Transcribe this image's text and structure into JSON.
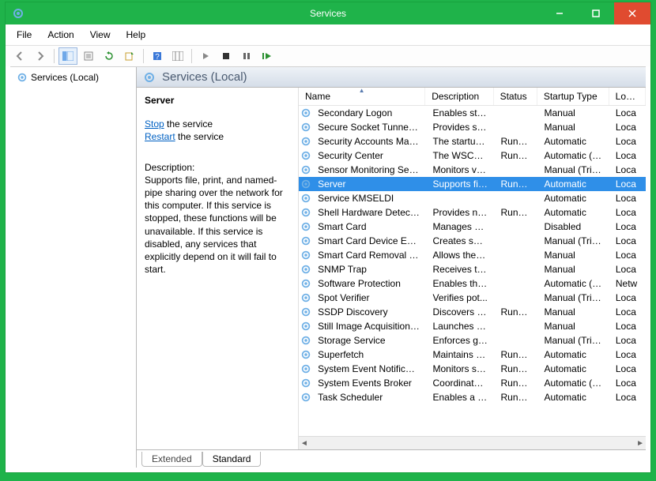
{
  "window": {
    "title": "Services"
  },
  "menu": {
    "file": "File",
    "action": "Action",
    "view": "View",
    "help": "Help"
  },
  "tree": {
    "root": "Services (Local)"
  },
  "header": {
    "title": "Services (Local)"
  },
  "detail": {
    "name": "Server",
    "stop_label": "Stop",
    "stop_suffix": " the service",
    "restart_label": "Restart",
    "restart_suffix": " the service",
    "desc_label": "Description:",
    "desc_text": "Supports file, print, and named-pipe sharing over the network for this computer. If this service is stopped, these functions will be unavailable. If this service is disabled, any services that explicitly depend on it will fail to start."
  },
  "columns": {
    "name": "Name",
    "description": "Description",
    "status": "Status",
    "startup": "Startup Type",
    "logon": "Log On As"
  },
  "rows": [
    {
      "name": "Secondary Logon",
      "description": "Enables star...",
      "status": "",
      "startup": "Manual",
      "logon": "Loca",
      "selected": false
    },
    {
      "name": "Secure Socket Tunneling Pr...",
      "description": "Provides su...",
      "status": "",
      "startup": "Manual",
      "logon": "Loca",
      "selected": false
    },
    {
      "name": "Security Accounts Manager",
      "description": "The startup ...",
      "status": "Running",
      "startup": "Automatic",
      "logon": "Loca",
      "selected": false
    },
    {
      "name": "Security Center",
      "description": "The WSCSV...",
      "status": "Running",
      "startup": "Automatic (D...",
      "logon": "Loca",
      "selected": false
    },
    {
      "name": "Sensor Monitoring Service",
      "description": "Monitors va...",
      "status": "",
      "startup": "Manual (Trig...",
      "logon": "Loca",
      "selected": false
    },
    {
      "name": "Server",
      "description": "Supports fil...",
      "status": "Running",
      "startup": "Automatic",
      "logon": "Loca",
      "selected": true
    },
    {
      "name": "Service KMSELDI",
      "description": "",
      "status": "",
      "startup": "Automatic",
      "logon": "Loca",
      "selected": false
    },
    {
      "name": "Shell Hardware Detection",
      "description": "Provides no...",
      "status": "Running",
      "startup": "Automatic",
      "logon": "Loca",
      "selected": false
    },
    {
      "name": "Smart Card",
      "description": "Manages ac...",
      "status": "",
      "startup": "Disabled",
      "logon": "Loca",
      "selected": false
    },
    {
      "name": "Smart Card Device Enumera...",
      "description": "Creates soft...",
      "status": "",
      "startup": "Manual (Trig...",
      "logon": "Loca",
      "selected": false
    },
    {
      "name": "Smart Card Removal Policy",
      "description": "Allows the s...",
      "status": "",
      "startup": "Manual",
      "logon": "Loca",
      "selected": false
    },
    {
      "name": "SNMP Trap",
      "description": "Receives tra...",
      "status": "",
      "startup": "Manual",
      "logon": "Loca",
      "selected": false
    },
    {
      "name": "Software Protection",
      "description": "Enables the ...",
      "status": "",
      "startup": "Automatic (D...",
      "logon": "Netw",
      "selected": false
    },
    {
      "name": "Spot Verifier",
      "description": "Verifies pot...",
      "status": "",
      "startup": "Manual (Trig...",
      "logon": "Loca",
      "selected": false
    },
    {
      "name": "SSDP Discovery",
      "description": "Discovers n...",
      "status": "Running",
      "startup": "Manual",
      "logon": "Loca",
      "selected": false
    },
    {
      "name": "Still Image Acquisition Events",
      "description": "Launches a...",
      "status": "",
      "startup": "Manual",
      "logon": "Loca",
      "selected": false
    },
    {
      "name": "Storage Service",
      "description": "Enforces gr...",
      "status": "",
      "startup": "Manual (Trig...",
      "logon": "Loca",
      "selected": false
    },
    {
      "name": "Superfetch",
      "description": "Maintains a...",
      "status": "Running",
      "startup": "Automatic",
      "logon": "Loca",
      "selected": false
    },
    {
      "name": "System Event Notification S...",
      "description": "Monitors sy...",
      "status": "Running",
      "startup": "Automatic",
      "logon": "Loca",
      "selected": false
    },
    {
      "name": "System Events Broker",
      "description": "Coordinates...",
      "status": "Running",
      "startup": "Automatic (T...",
      "logon": "Loca",
      "selected": false
    },
    {
      "name": "Task Scheduler",
      "description": "Enables a us...",
      "status": "Running",
      "startup": "Automatic",
      "logon": "Loca",
      "selected": false
    }
  ],
  "tabs": {
    "extended": "Extended",
    "standard": "Standard"
  }
}
